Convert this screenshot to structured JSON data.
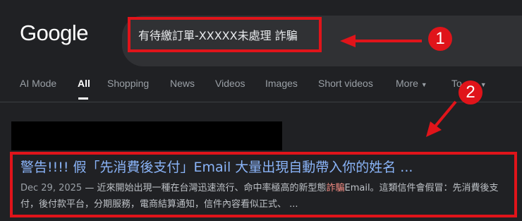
{
  "logo": {
    "text": "Google"
  },
  "search": {
    "query": "有待繳訂單-XXXXX未處理 詐騙"
  },
  "annotations": {
    "badge1": "1",
    "badge2": "2"
  },
  "tabs": [
    {
      "label": "AI Mode"
    },
    {
      "label": "All"
    },
    {
      "label": "Shopping"
    },
    {
      "label": "News"
    },
    {
      "label": "Videos"
    },
    {
      "label": "Images"
    },
    {
      "label": "Short videos"
    },
    {
      "label": "More"
    },
    {
      "label": "To"
    }
  ],
  "result": {
    "title": "警告!!!! 假「先消費後支付」Email 大量出現自動帶入你的姓名 ...",
    "date": "Dec 29, 2025",
    "sep": " — ",
    "snippet_a": "近來開始出現一種在台灣迅速流行、命中率極高的新型態",
    "snippet_highlight": "詐騙",
    "snippet_b": "Email。這類信件會假冒：先消費後支付，後付款平台，分期服務，電商結算通知，信件內容看似正式、 ..."
  },
  "colors": {
    "background": "#202124",
    "annotation_red": "#e0141a",
    "link_blue": "#8ab4f8",
    "highlight": "#f28b82"
  }
}
